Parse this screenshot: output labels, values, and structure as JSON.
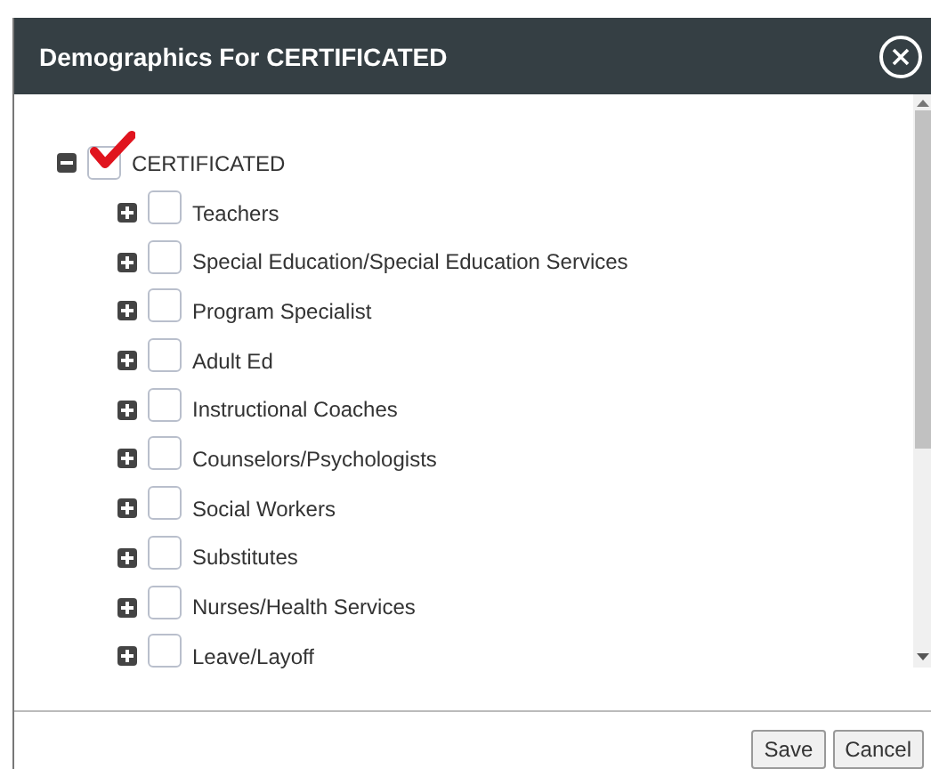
{
  "dialog": {
    "title": "Demographics For CERTIFICATED"
  },
  "tree": [
    {
      "label": "CERTIFICATED",
      "expanded": true,
      "checked": true,
      "children": [
        {
          "label": "Teachers",
          "expanded": false,
          "checked": false
        },
        {
          "label": "Special Education/Special Education Services",
          "expanded": false,
          "checked": false
        },
        {
          "label": "Program Specialist",
          "expanded": false,
          "checked": false
        },
        {
          "label": "Adult Ed",
          "expanded": false,
          "checked": false
        },
        {
          "label": "Instructional Coaches",
          "expanded": false,
          "checked": false
        },
        {
          "label": "Counselors/Psychologists",
          "expanded": false,
          "checked": false
        },
        {
          "label": "Social Workers",
          "expanded": false,
          "checked": false
        },
        {
          "label": "Substitutes",
          "expanded": false,
          "checked": false
        },
        {
          "label": "Nurses/Health Services",
          "expanded": false,
          "checked": false
        },
        {
          "label": "Leave/Layoff",
          "expanded": false,
          "checked": false
        }
      ]
    }
  ],
  "buttons": [
    "Save",
    "Cancel"
  ]
}
